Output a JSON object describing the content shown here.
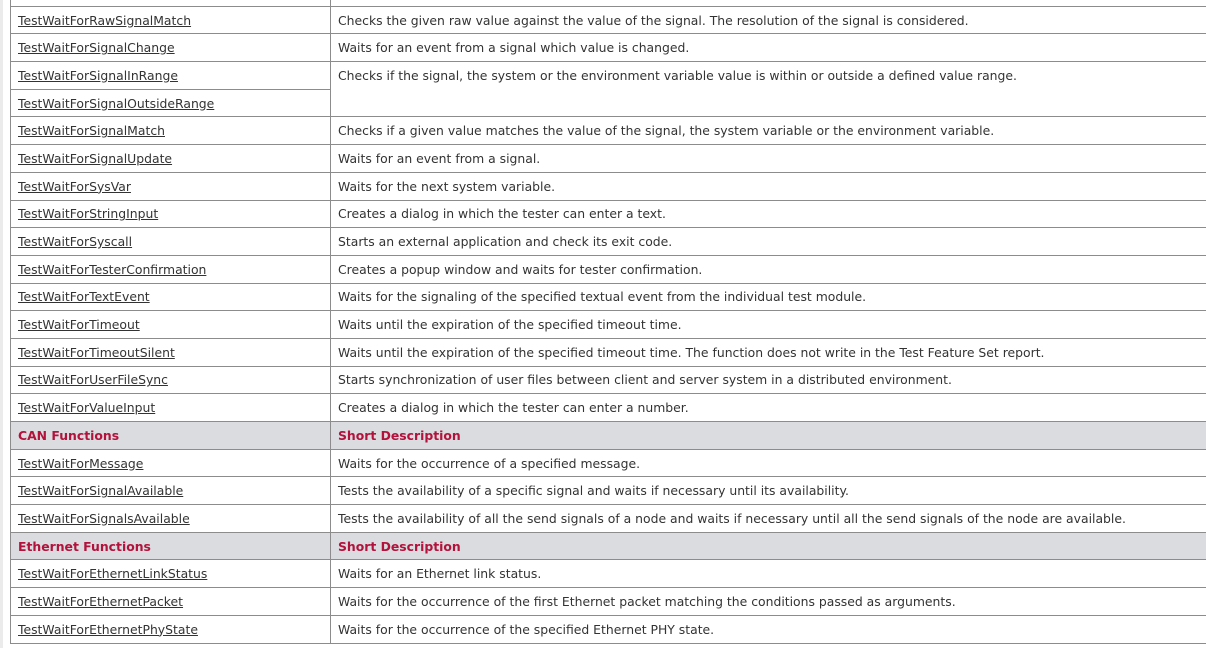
{
  "general_rows": [
    {
      "name": "",
      "description": ""
    },
    {
      "name": "TestWaitForRawSignalMatch",
      "description": "Checks the given raw value against the value of the signal. The resolution of the signal is considered."
    },
    {
      "name": "TestWaitForSignalChange",
      "description": "Waits for an event from a signal which value is changed."
    }
  ],
  "range_group": {
    "names": [
      "TestWaitForSignalInRange",
      "TestWaitForSignalOutsideRange"
    ],
    "description": "Checks if the signal, the system or the environment variable value is within or outside a defined value range."
  },
  "general_rows_2": [
    {
      "name": "TestWaitForSignalMatch",
      "description": "Checks if a given value matches the value of the signal, the system variable or the environment variable."
    },
    {
      "name": "TestWaitForSignalUpdate",
      "description": "Waits for an event from a signal."
    },
    {
      "name": "TestWaitForSysVar",
      "description": "Waits for the next system variable."
    },
    {
      "name": "TestWaitForStringInput",
      "description": "Creates a dialog in which the tester can enter a text."
    },
    {
      "name": "TestWaitForSyscall",
      "description": "Starts an external application and check its exit code."
    },
    {
      "name": "TestWaitForTesterConfirmation",
      "description": "Creates a popup window and waits for tester confirmation."
    },
    {
      "name": "TestWaitForTextEvent",
      "description": "Waits for the signaling of the specified textual event from the individual test module."
    },
    {
      "name": "TestWaitForTimeout",
      "description": "Waits until the expiration of the specified timeout time."
    },
    {
      "name": "TestWaitForTimeoutSilent",
      "description": "Waits until the expiration of the specified timeout time. The function does not write in the Test Feature Set report."
    },
    {
      "name": "TestWaitForUserFileSync",
      "description": "Starts synchronization of user files between client and server system in a distributed environment."
    },
    {
      "name": "TestWaitForValueInput",
      "description": "Creates a dialog in which the tester can enter a number."
    }
  ],
  "can_section": {
    "header": "CAN Functions",
    "desc_header": "Short Description",
    "rows": [
      {
        "name": "TestWaitForMessage",
        "description": "Waits for the occurrence of a specified message."
      },
      {
        "name": "TestWaitForSignalAvailable",
        "description": "Tests the availability of a specific signal and waits if necessary until its availability."
      },
      {
        "name": "TestWaitForSignalsAvailable",
        "description": "Tests the availability of all the send signals of a node and waits if necessary until all the send signals of the node are available."
      }
    ]
  },
  "ethernet_section": {
    "header": "Ethernet Functions",
    "desc_header": "Short Description",
    "rows": [
      {
        "name": "TestWaitForEthernetLinkStatus",
        "description": "Waits for an Ethernet link status."
      },
      {
        "name": "TestWaitForEthernetPacket",
        "description": "Waits for the occurrence of the first Ethernet packet matching the conditions passed as arguments."
      },
      {
        "name": "TestWaitForEthernetPhyState",
        "description": "Waits for the occurrence of the specified Ethernet PHY state."
      }
    ]
  },
  "colors": {
    "section_header_text": "#b3123c",
    "section_header_bg": "#dadcdf",
    "border": "#8c8c8c",
    "text": "#333333"
  }
}
